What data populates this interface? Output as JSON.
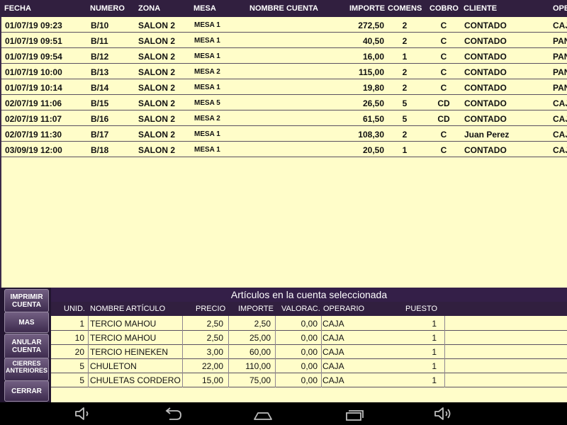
{
  "tickets": {
    "headers": [
      "FECHA",
      "NUMERO",
      "ZONA",
      "MESA",
      "NOMBRE CUENTA",
      "IMPORTE",
      "COMENS",
      "COBRO",
      "CLIENTE",
      "OPE"
    ],
    "rows": [
      [
        "01/07/19 09:23",
        "B/10",
        "SALON 2",
        "MESA 1",
        "",
        "272,50",
        "2",
        "C",
        "CONTADO",
        "CAJ"
      ],
      [
        "01/07/19 09:51",
        "B/11",
        "SALON 2",
        "MESA 1",
        "",
        "40,50",
        "2",
        "C",
        "CONTADO",
        "PAN"
      ],
      [
        "01/07/19 09:54",
        "B/12",
        "SALON 2",
        "MESA 1",
        "",
        "16,00",
        "1",
        "C",
        "CONTADO",
        "PAN"
      ],
      [
        "01/07/19 10:00",
        "B/13",
        "SALON 2",
        "MESA 2",
        "",
        "115,00",
        "2",
        "C",
        "CONTADO",
        "PAN"
      ],
      [
        "01/07/19 10:14",
        "B/14",
        "SALON 2",
        "MESA 1",
        "",
        "19,80",
        "2",
        "C",
        "CONTADO",
        "PAN"
      ],
      [
        "02/07/19 11:06",
        "B/15",
        "SALON 2",
        "MESA 5",
        "",
        "26,50",
        "5",
        "CD",
        "CONTADO",
        "CAJ"
      ],
      [
        "02/07/19 11:07",
        "B/16",
        "SALON 2",
        "MESA 2",
        "",
        "61,50",
        "5",
        "CD",
        "CONTADO",
        "CAJ"
      ],
      [
        "02/07/19 11:30",
        "B/17",
        "SALON 2",
        "MESA 1",
        "",
        "108,30",
        "2",
        "C",
        "Juan Perez",
        "CAJ"
      ],
      [
        "03/09/19 12:00",
        "B/18",
        "SALON 2",
        "MESA 1",
        "",
        "20,50",
        "1",
        "C",
        "CONTADO",
        "CAJ"
      ]
    ]
  },
  "left_buttons": [
    "IMPRIMIR CUENTA",
    "MAS",
    "ANULAR CUENTA",
    "CIERRES ANTERIORES",
    "CERRAR"
  ],
  "detail": {
    "title": "Artículos en la cuenta seleccionada",
    "headers": [
      "UNID.",
      "NOMBRE ARTÍCULO",
      "PRECIO",
      "IMPORTE",
      "VALORAC.",
      "OPERARIO",
      "PUESTO"
    ],
    "rows": [
      [
        "1",
        "TERCIO MAHOU",
        "2,50",
        "2,50",
        "0,00",
        "CAJA",
        "1"
      ],
      [
        "10",
        "TERCIO MAHOU",
        "2,50",
        "25,00",
        "0,00",
        "CAJA",
        "1"
      ],
      [
        "20",
        "TERCIO HEINEKEN",
        "3,00",
        "60,00",
        "0,00",
        "CAJA",
        "1"
      ],
      [
        "5",
        "CHULETON",
        "22,00",
        "110,00",
        "0,00",
        "CAJA",
        "1"
      ],
      [
        "5",
        "CHULETAS CORDERO",
        "15,00",
        "75,00",
        "0,00",
        "CAJA",
        "1"
      ]
    ]
  },
  "navbar": {
    "icons": [
      "volume-down-icon",
      "back-icon",
      "home-icon",
      "recent-apps-icon",
      "volume-up-icon"
    ]
  },
  "colors": {
    "background": "#fffdc9",
    "header": "#311f3f",
    "button": "#5a4a6e"
  }
}
